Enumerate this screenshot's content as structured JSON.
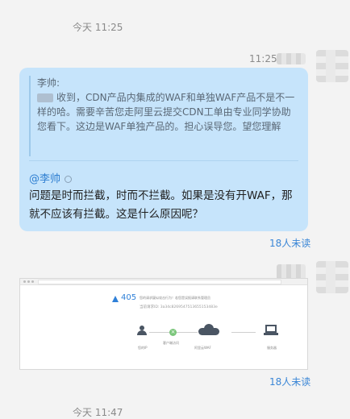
{
  "chat": {
    "timestamp_top": "今天 11:25",
    "timestamp_bottom": "今天 11:47",
    "sender_time": "11:25",
    "message": {
      "quote_author": "李帅:",
      "quote_text": "收到，CDN产品内集成的WAF和单独WAF产品不是不一样的哈。需要辛苦您走阿里云提交CDN工单由专业同学协助您看下。这边是WAF单独产品的。担心误导您。望您理解",
      "mention": "@李帅",
      "text": "问题是时而拦截，时而不拦截。如果是没有开WAF，那就不应该有拦截。这是什么原因呢？",
      "unread": "18人未读"
    },
    "image_message": {
      "error_code": "405",
      "error_desc": "您的请求疑似攻击行为！若您是误报请联系管理员",
      "error_id": "当前请求ID: 3a34c8269547513655153483e",
      "node_visitor": "您的IP",
      "node_arrow": "客户端访问",
      "node_firewall": "阿里云WAF",
      "node_server": "服务器",
      "unread": "18人未读"
    }
  }
}
